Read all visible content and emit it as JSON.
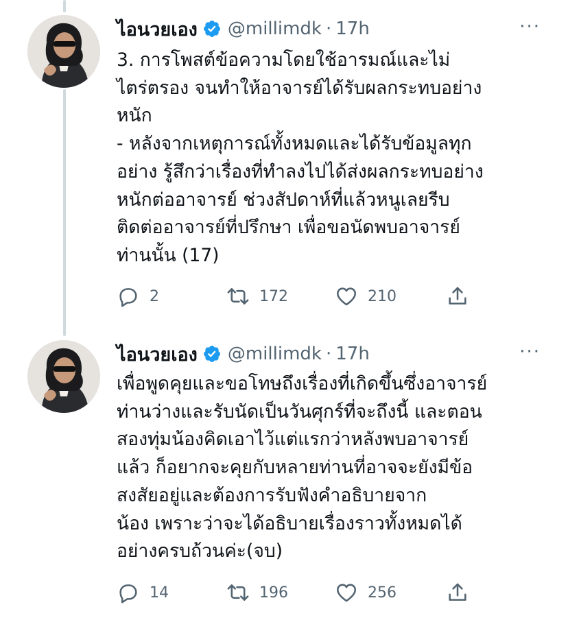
{
  "tweets": [
    {
      "display_name": "ไอนวยเอง",
      "handle": "@millimdk",
      "separator": "·",
      "time": "17h",
      "more": "···",
      "lines": [
        "3. การโพสต์ข้อความโดยใช้อารมณ์และไม่",
        "ไตร่ตรอง จนทำให้อาจารย์ได้รับผลกระทบอย่าง",
        "หนัก",
        "- หลังจากเหตุการณ์ทั้งหมดและได้รับข้อมูลทุก",
        "อย่าง รู้สึกว่าเรื่องที่ทำลงไปได้ส่งผลกระทบอย่าง",
        "หนักต่ออาจารย์ ช่วงสัปดาห์ที่แล้วหนูเลยรีบ",
        "ติดต่ออาจารย์ที่ปรึกษา เพื่อขอนัดพบอาจารย์",
        "ท่านนั้น (17)"
      ],
      "replies": "2",
      "retweets": "172",
      "likes": "210"
    },
    {
      "display_name": "ไอนวยเอง",
      "handle": "@millimdk",
      "separator": "·",
      "time": "17h",
      "more": "···",
      "lines": [
        "เพื่อพูดคุยและขอโทษถึงเรื่องที่เกิดขึ้นซึ่งอาจารย์",
        "ท่านว่างและรับนัดเป็นวันศุกร์ที่จะถึงนี้ และตอน",
        "สองทุ่มน้องคิดเอาไว้แต่แรกว่าหลังพบอาจารย์",
        "แล้ว ก็อยากจะคุยกับหลายท่านที่อาจจะยังมีข้อ",
        "สงสัยอยู่และต้องการรับฟังคำอธิบายจาก",
        "น้อง เพราะว่าจะได้อธิบายเรื่องราวทั้งหมดได้",
        "อย่างครบถ้วนค่ะ(จบ)"
      ],
      "replies": "14",
      "retweets": "196",
      "likes": "256"
    }
  ],
  "colors": {
    "text": "#0f1419",
    "secondary": "#536471",
    "verified": "#1d9bf0",
    "thread_line": "#cfd9de"
  }
}
